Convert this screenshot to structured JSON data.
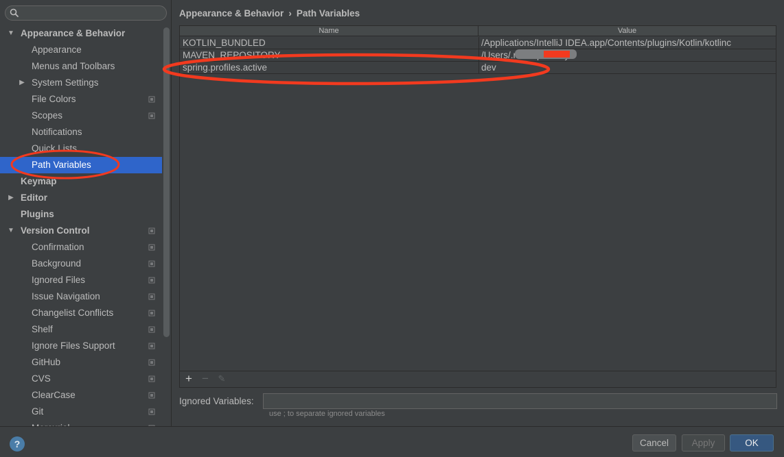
{
  "search": {
    "placeholder": ""
  },
  "sidebar": {
    "items": [
      {
        "label": "Appearance & Behavior",
        "level": 0,
        "bold": true,
        "arrow": "expanded",
        "proj_icon": false
      },
      {
        "label": "Appearance",
        "level": 1,
        "bold": false,
        "arrow": "none",
        "proj_icon": false
      },
      {
        "label": "Menus and Toolbars",
        "level": 1,
        "bold": false,
        "arrow": "none",
        "proj_icon": false
      },
      {
        "label": "System Settings",
        "level": 1,
        "bold": false,
        "arrow": "collapsed",
        "proj_icon": false
      },
      {
        "label": "File Colors",
        "level": 1,
        "bold": false,
        "arrow": "none",
        "proj_icon": true
      },
      {
        "label": "Scopes",
        "level": 1,
        "bold": false,
        "arrow": "none",
        "proj_icon": true
      },
      {
        "label": "Notifications",
        "level": 1,
        "bold": false,
        "arrow": "none",
        "proj_icon": false
      },
      {
        "label": "Quick Lists",
        "level": 1,
        "bold": false,
        "arrow": "none",
        "proj_icon": false
      },
      {
        "label": "Path Variables",
        "level": 1,
        "bold": false,
        "arrow": "none",
        "proj_icon": false,
        "selected": true
      },
      {
        "label": "Keymap",
        "level": 0,
        "bold": true,
        "arrow": "none",
        "proj_icon": false
      },
      {
        "label": "Editor",
        "level": 0,
        "bold": true,
        "arrow": "collapsed",
        "proj_icon": false
      },
      {
        "label": "Plugins",
        "level": 0,
        "bold": true,
        "arrow": "none",
        "proj_icon": false
      },
      {
        "label": "Version Control",
        "level": 0,
        "bold": true,
        "arrow": "expanded",
        "proj_icon": true
      },
      {
        "label": "Confirmation",
        "level": 1,
        "bold": false,
        "arrow": "none",
        "proj_icon": true
      },
      {
        "label": "Background",
        "level": 1,
        "bold": false,
        "arrow": "none",
        "proj_icon": true
      },
      {
        "label": "Ignored Files",
        "level": 1,
        "bold": false,
        "arrow": "none",
        "proj_icon": true
      },
      {
        "label": "Issue Navigation",
        "level": 1,
        "bold": false,
        "arrow": "none",
        "proj_icon": true
      },
      {
        "label": "Changelist Conflicts",
        "level": 1,
        "bold": false,
        "arrow": "none",
        "proj_icon": true
      },
      {
        "label": "Shelf",
        "level": 1,
        "bold": false,
        "arrow": "none",
        "proj_icon": true
      },
      {
        "label": "Ignore Files Support",
        "level": 1,
        "bold": false,
        "arrow": "none",
        "proj_icon": true
      },
      {
        "label": "GitHub",
        "level": 1,
        "bold": false,
        "arrow": "none",
        "proj_icon": true
      },
      {
        "label": "CVS",
        "level": 1,
        "bold": false,
        "arrow": "none",
        "proj_icon": true
      },
      {
        "label": "ClearCase",
        "level": 1,
        "bold": false,
        "arrow": "none",
        "proj_icon": true
      },
      {
        "label": "Git",
        "level": 1,
        "bold": false,
        "arrow": "none",
        "proj_icon": true
      },
      {
        "label": "Mercurial",
        "level": 1,
        "bold": false,
        "arrow": "none",
        "proj_icon": true
      }
    ]
  },
  "breadcrumb": {
    "parent": "Appearance & Behavior",
    "separator": "›",
    "current": "Path Variables"
  },
  "table": {
    "headers": {
      "name": "Name",
      "value": "Value"
    },
    "rows": [
      {
        "name": "KOTLIN_BUNDLED",
        "value": "/Applications/IntelliJ IDEA.app/Contents/plugins/Kotlin/kotlinc"
      },
      {
        "name": "MAVEN_REPOSITORY",
        "value": "/Users/.m2/repository"
      },
      {
        "name": "spring.profiles.active",
        "value": "dev"
      }
    ]
  },
  "toolbar": {
    "add": "+",
    "remove": "−",
    "edit": "✎"
  },
  "ignored": {
    "label": "Ignored Variables:",
    "value": "",
    "hint": "use ; to separate ignored variables"
  },
  "buttons": {
    "help": "?",
    "cancel": "Cancel",
    "apply": "Apply",
    "ok": "OK"
  },
  "colors": {
    "background": "#3c3f41",
    "selection": "#2f65ca",
    "annotation": "#f23a1f",
    "ok_button": "#365880"
  }
}
